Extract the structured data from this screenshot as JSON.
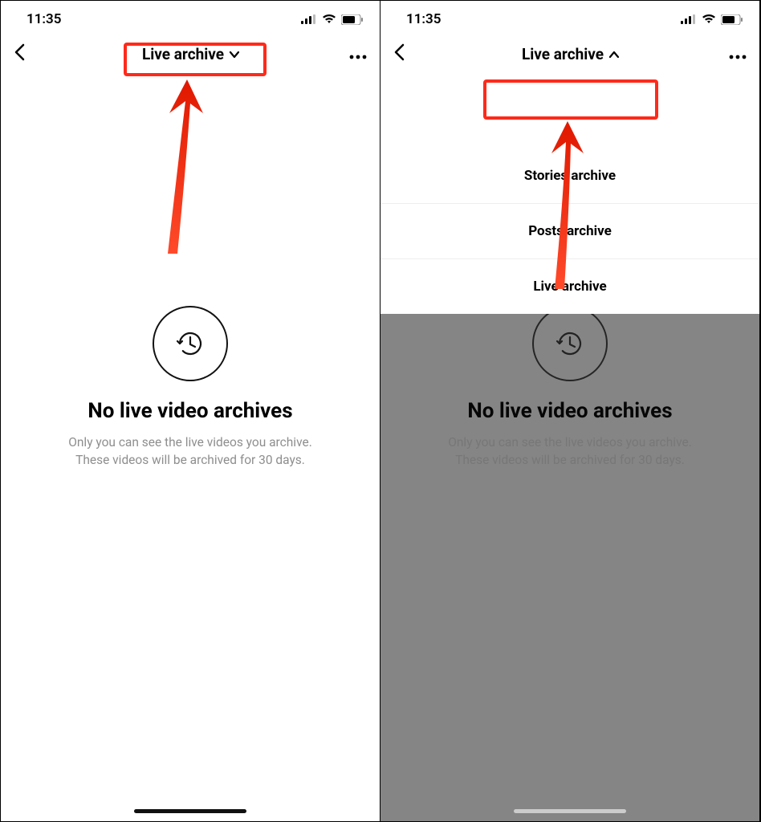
{
  "status": {
    "time": "11:35"
  },
  "nav": {
    "title": "Live archive",
    "dropdown_state_closed": "down",
    "dropdown_state_open": "up"
  },
  "empty": {
    "title": "No live video archives",
    "desc_line1": "Only you can see the live videos you archive.",
    "desc_line2": "These videos will be archived for 30 days."
  },
  "dropdown": {
    "item1": "Stories archive",
    "item2": "Posts archive",
    "item3": "Live archive"
  }
}
